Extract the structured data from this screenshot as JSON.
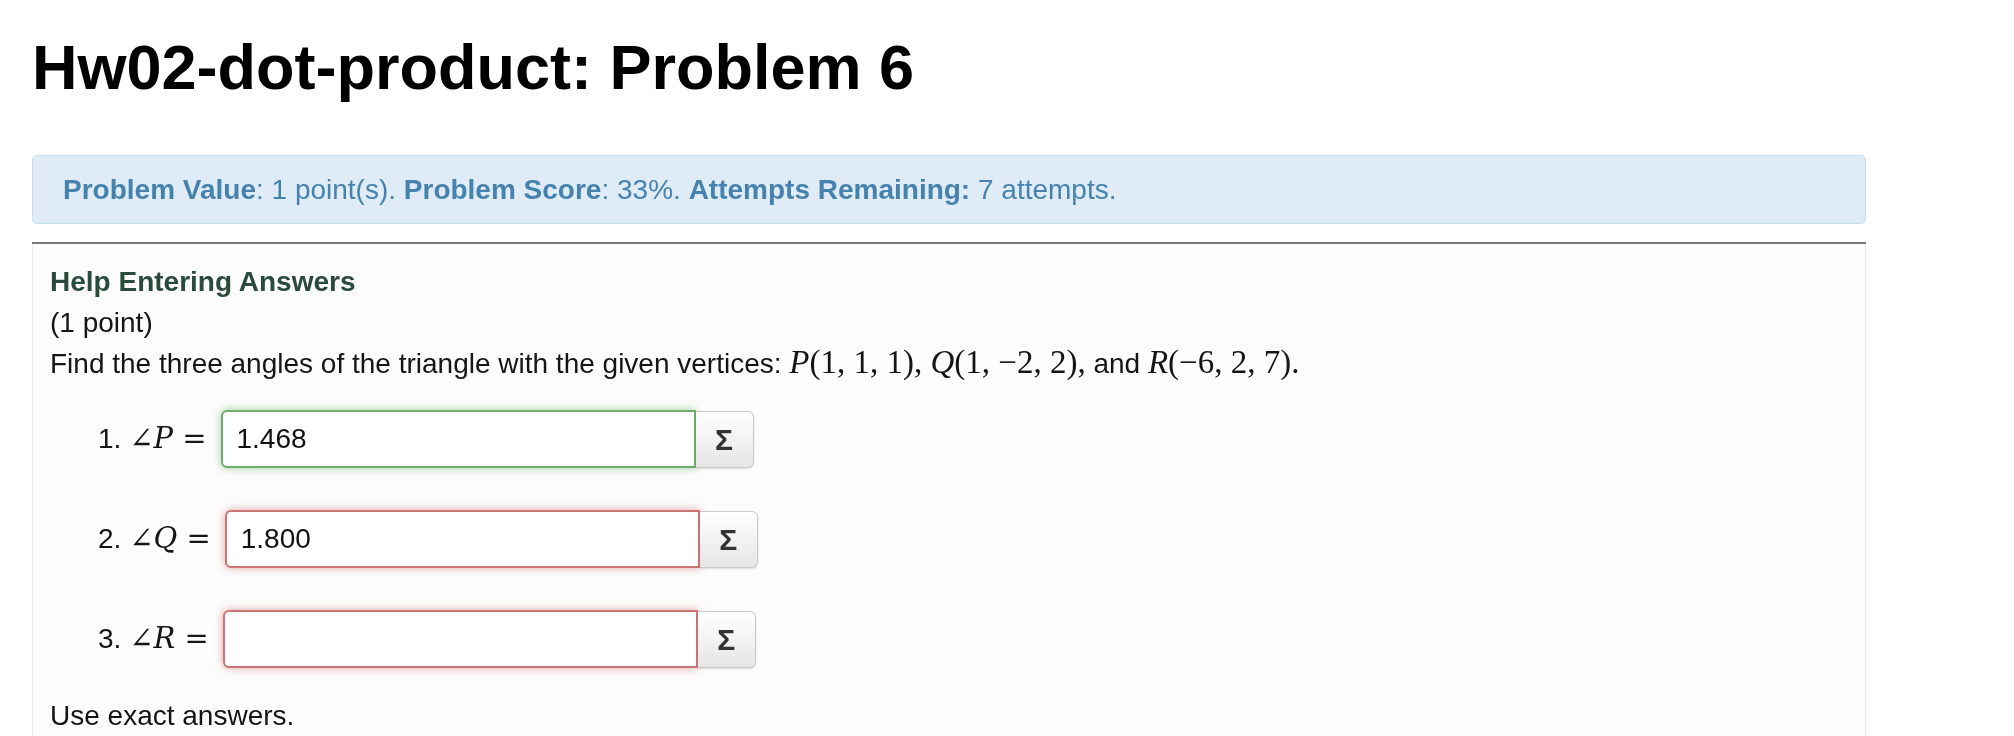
{
  "title": "Hw02-dot-product: Problem 6",
  "problem_info": {
    "text": "**Problem Value**: 1 point(s). **Problem Score**: 33%. **Attempts Remaining:** 7 attempts."
  },
  "problem": {
    "help_link": "Help Entering Answers",
    "points": "(1 point)",
    "question": [
      {
        "kind": "text",
        "text": "Find the three angles of the triangle with the given vertices: "
      },
      {
        "kind": "math",
        "text": "*P*(1, 1, 1), *Q*(1, −2, 2),"
      },
      {
        "kind": "text",
        "text": " and "
      },
      {
        "kind": "math",
        "text": "*R*(−6, 2, 7)."
      }
    ],
    "answers": [
      {
        "number": "1.",
        "label": "∠*P* =",
        "value": "1.468",
        "correct": true,
        "button": "Σ"
      },
      {
        "number": "2.",
        "label": "∠*Q* =",
        "value": "1.800",
        "correct": false,
        "button": "Σ"
      },
      {
        "number": "3.",
        "label": "∠*R* =",
        "correct": false,
        "button": "Σ"
      }
    ],
    "note": "Use exact answers."
  }
}
